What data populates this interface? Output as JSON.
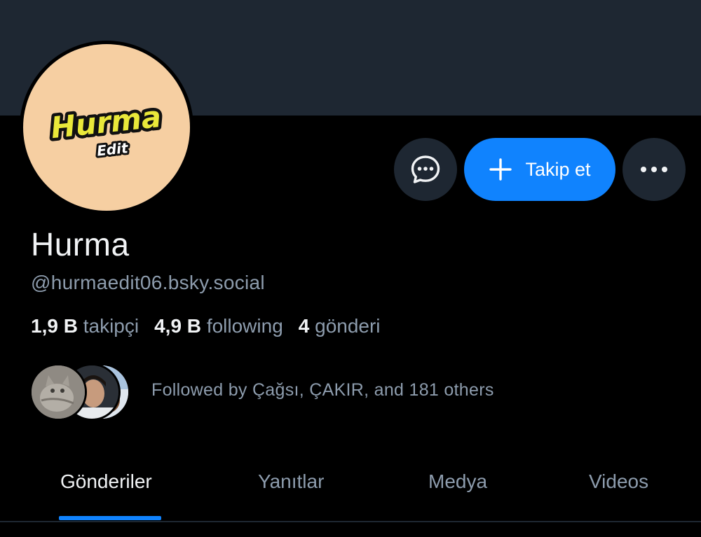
{
  "profile": {
    "display_name": "Hurma",
    "handle": "@hurmaedit06.bsky.social",
    "avatar": {
      "logo_text": "Hurma",
      "logo_subtext": "Edit",
      "background_color": "#f6cfa2"
    }
  },
  "actions": {
    "message_icon": "message-bubble-icon",
    "follow_label": "Takip et",
    "follow_icon": "plus-icon",
    "more_icon": "ellipsis-icon"
  },
  "stats": {
    "followers_count": "1,9 B",
    "followers_label": "takipçi",
    "following_count": "4,9 B",
    "following_label": "following",
    "posts_count": "4",
    "posts_label": "gönderi"
  },
  "followed_by": {
    "text": "Followed by Çağsı, ÇAKIR, and 181 others"
  },
  "tabs": [
    {
      "label": "Gönderiler",
      "active": true
    },
    {
      "label": "Yanıtlar",
      "active": false
    },
    {
      "label": "Medya",
      "active": false
    },
    {
      "label": "Videos",
      "active": false
    }
  ],
  "colors": {
    "background": "#000000",
    "banner": "#1e2732",
    "accent": "#1083fe",
    "text_primary": "#f1f3f5",
    "text_secondary": "#8d9cad"
  }
}
